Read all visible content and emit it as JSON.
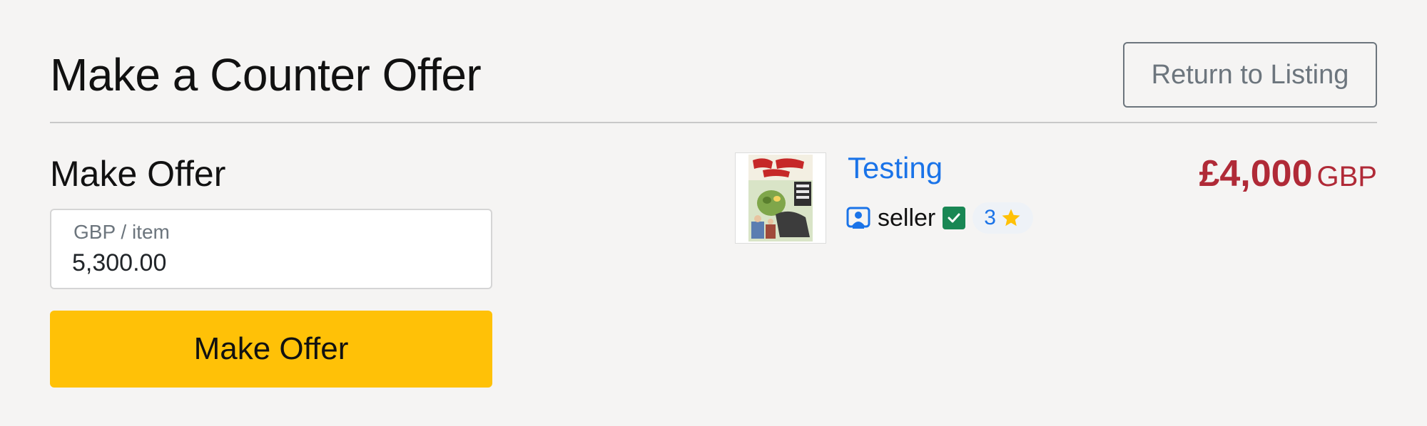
{
  "page": {
    "title": "Make a Counter Offer",
    "return_label": "Return to Listing"
  },
  "offer_form": {
    "heading": "Make Offer",
    "field_label": "GBP / item",
    "field_value": "5,300.00",
    "submit_label": "Make Offer"
  },
  "listing": {
    "title": "Testing",
    "seller_name": "seller",
    "seller_verified": true,
    "rating_count": "3",
    "price": "£4,000",
    "currency": "GBP",
    "thumbnail_icon": "comic-cover-image"
  },
  "icons": {
    "seller": "seller-profile-icon",
    "verified": "checkmark-icon",
    "rating": "star-icon"
  },
  "colors": {
    "background": "#f5f4f3",
    "accent_button": "#ffc107",
    "link": "#1a73e8",
    "price": "#b02a37",
    "verified": "#198754",
    "star": "#ffc107"
  }
}
